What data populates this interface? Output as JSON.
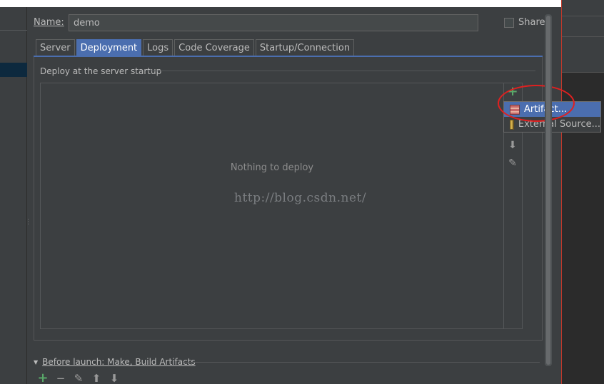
{
  "config": {
    "name_label": "Name:",
    "name_value": "demo",
    "share_label": "Share"
  },
  "tabs": [
    {
      "label": "Server"
    },
    {
      "label": "Deployment"
    },
    {
      "label": "Logs"
    },
    {
      "label": "Code Coverage"
    },
    {
      "label": "Startup/Connection"
    }
  ],
  "active_tab": "Deployment",
  "deployment": {
    "section_title": "Deploy at the server startup",
    "empty_text": "Nothing to deploy",
    "watermark": "http://blog.csdn.net/"
  },
  "popup": {
    "items": [
      {
        "label": "Artifact...",
        "icon": "artifact-icon",
        "selected": true
      },
      {
        "label": "External Source...",
        "icon": "external-source-icon",
        "selected": false
      }
    ]
  },
  "before_launch": {
    "label": "Before launch: Make, Build Artifacts"
  },
  "colors": {
    "accent": "#4b6eaf",
    "background": "#3c3f41",
    "add_green": "#59a869",
    "annotation_red": "#e02020"
  }
}
